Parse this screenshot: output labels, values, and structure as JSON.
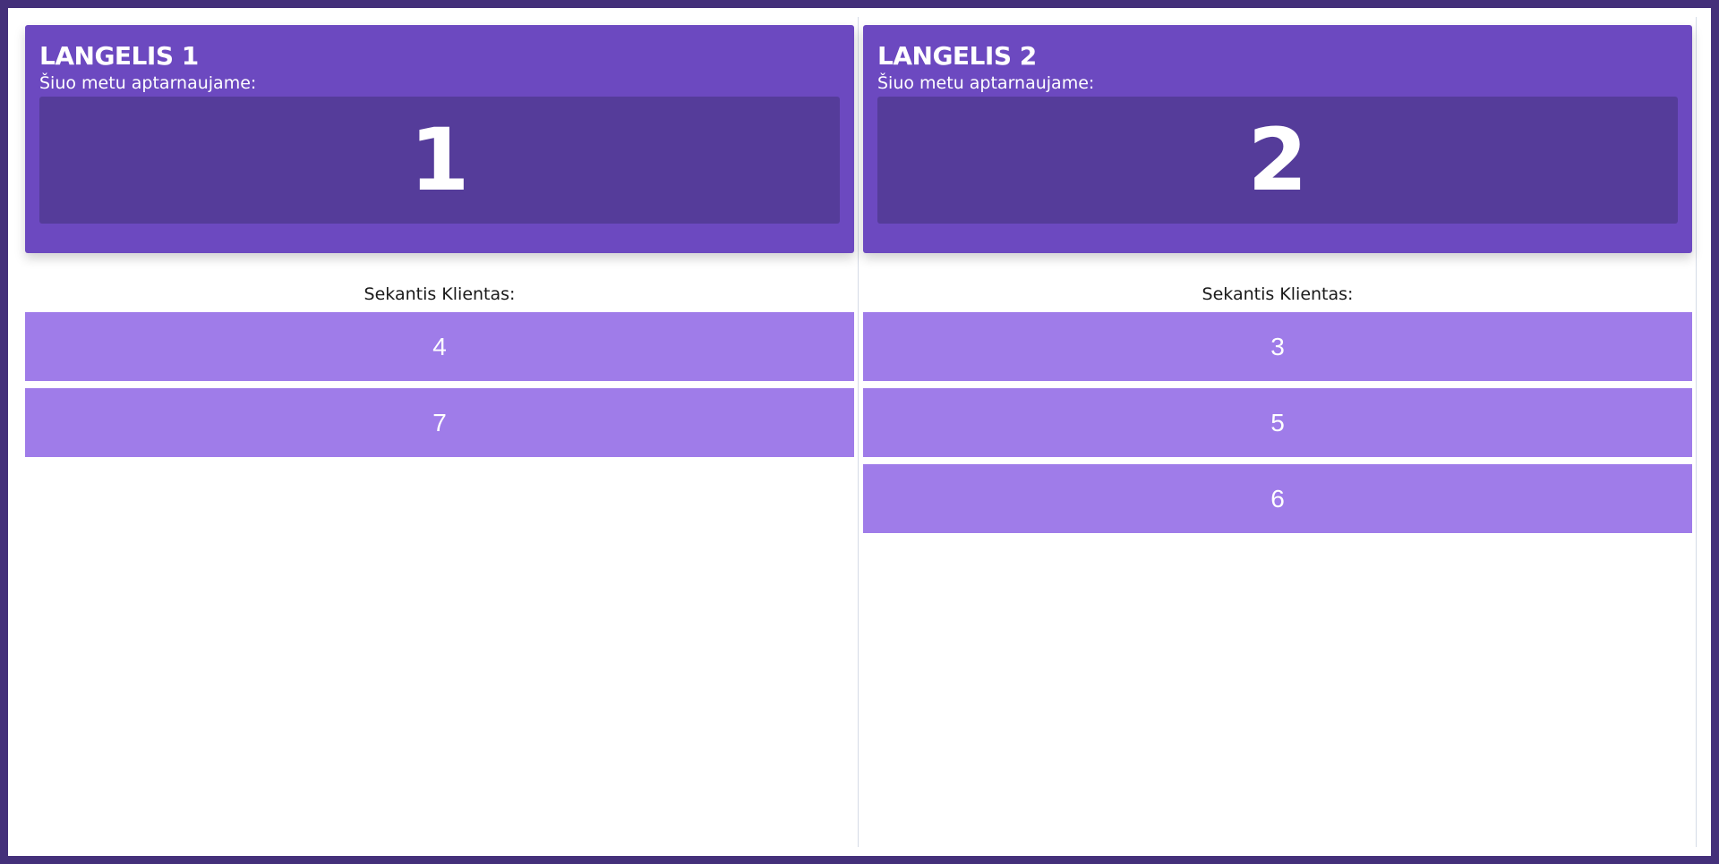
{
  "windows": [
    {
      "title": "LANGELIS 1",
      "subtitle": "Šiuo metu aptarnaujame:",
      "current_number": "1",
      "next_label": "Sekantis Klientas:",
      "queue": [
        "4",
        "7"
      ]
    },
    {
      "title": "LANGELIS 2",
      "subtitle": "Šiuo metu aptarnaujame:",
      "current_number": "2",
      "next_label": "Sekantis Klientas:",
      "queue": [
        "3",
        "5",
        "6"
      ]
    }
  ],
  "colors": {
    "page_border": "#44307a",
    "card": "#6c49c0",
    "current_box": "#553c9a",
    "queue_item": "#9f7ce9"
  }
}
